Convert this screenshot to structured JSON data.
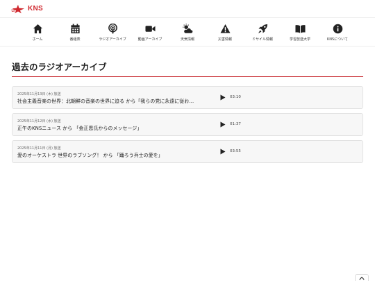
{
  "site": {
    "logo_text": "KNS",
    "brand_color": "#d0282e"
  },
  "nav": {
    "items": [
      {
        "label": "ホーム",
        "icon": "home-icon"
      },
      {
        "label": "番組表",
        "icon": "calendar-icon"
      },
      {
        "label": "ラジオアーカイブ",
        "icon": "podcast-icon"
      },
      {
        "label": "動画アーカイブ",
        "icon": "video-camera-icon"
      },
      {
        "label": "天気情報",
        "icon": "weather-icon"
      },
      {
        "label": "災害情報",
        "icon": "warning-icon"
      },
      {
        "label": "ミサイル情報",
        "icon": "rocket-icon"
      },
      {
        "label": "学習放送大学",
        "icon": "book-icon"
      },
      {
        "label": "KNSについて",
        "icon": "info-icon"
      }
    ]
  },
  "main": {
    "title": "過去のラジオアーカイブ",
    "archives": [
      {
        "date": "2025年11月13日 (木) 放送",
        "title": "社会主義音楽の世界：北朝鮮の音楽の世界に迫る から「我らの党に永遠に従お…",
        "duration": "03:10"
      },
      {
        "date": "2025年11月12日 (水) 放送",
        "title": "正午のKNSニュース から 「金正恩氏からのメッセージ」",
        "duration": "01:37"
      },
      {
        "date": "2025年11月11日 (月) 放送",
        "title": "愛のオーケストラ 世界のラブソング！ から 「踊ろう兵士の愛を」",
        "duration": "03:55"
      }
    ]
  }
}
